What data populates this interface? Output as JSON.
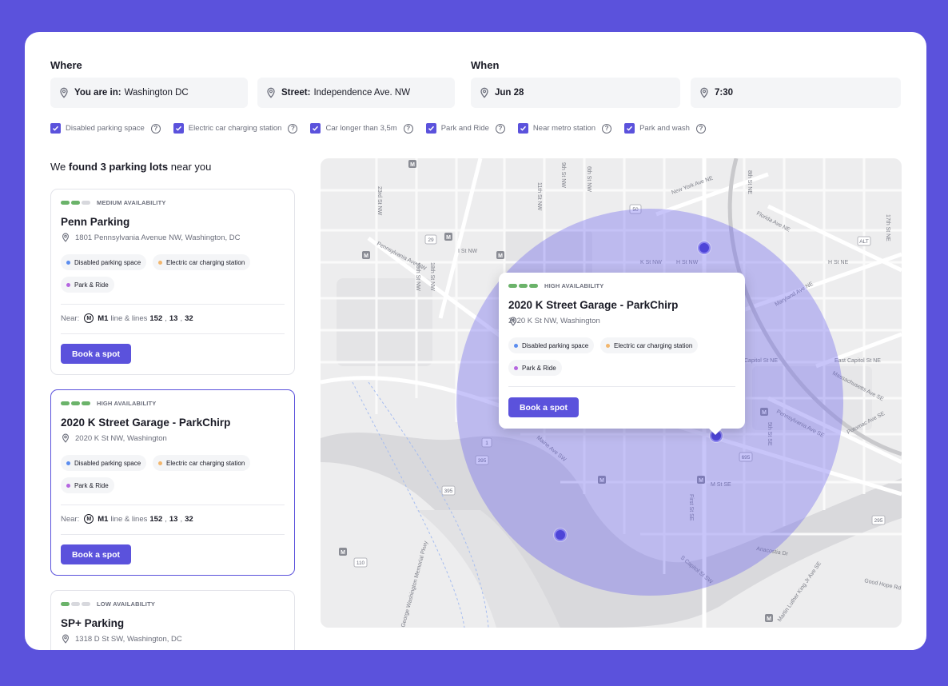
{
  "where": {
    "title": "Where",
    "location_label": "You are in:",
    "location_value": "Washington DC",
    "street_label": "Street:",
    "street_value": "Independence Ave. NW"
  },
  "when": {
    "title": "When",
    "date": "Jun 28",
    "time": "7:30"
  },
  "filters": [
    {
      "label": "Disabled parking space",
      "checked": true
    },
    {
      "label": "Electric car charging station",
      "checked": true
    },
    {
      "label": "Car longer than 3,5m",
      "checked": true
    },
    {
      "label": "Park and Ride",
      "checked": true
    },
    {
      "label": "Near metro station",
      "checked": true
    },
    {
      "label": "Park and wash",
      "checked": true
    }
  ],
  "results": {
    "prefix": "We",
    "highlight": "found 3 parking lots",
    "suffix": "near you"
  },
  "lots": [
    {
      "availability": "MEDIUM AVAILABILITY",
      "level": 2,
      "name": "Penn Parking",
      "address": "1801 Pennsylvania Avenue NW, Washington, DC",
      "tags": [
        "Disabled parking space",
        "Electric car charging station",
        "Park & Ride"
      ],
      "near_label": "Near:",
      "metro_icon": "M",
      "line": "M1",
      "lines_text": "line & lines",
      "line_152": "152",
      "line_13": "13",
      "line_32": "32",
      "button": "Book a spot"
    },
    {
      "availability": "HIGH AVAILABILITY",
      "level": 3,
      "name": "2020 K Street Garage - ParkChirp",
      "address": "2020 K St NW, Washington",
      "tags": [
        "Disabled parking space",
        "Electric car charging station",
        "Park & Ride"
      ],
      "near_label": "Near:",
      "metro_icon": "M",
      "line": "M1",
      "lines_text": "line & lines",
      "line_152": "152",
      "line_13": "13",
      "line_32": "32",
      "button": "Book a spot"
    },
    {
      "availability": "LOW AVAILABILITY",
      "level": 1,
      "name": "SP+ Parking",
      "address": "1318 D St SW, Washington, DC"
    }
  ],
  "popup": {
    "availability": "HIGH AVAILABILITY",
    "name": "2020 K Street Garage - ParkChirp",
    "address": "2020 K St NW, Washington",
    "tags": [
      "Disabled parking space",
      "Electric car charging station",
      "Park & Ride"
    ],
    "button": "Book a spot"
  },
  "map_labels": {
    "new_york_ave": "New York Ave NE",
    "florida_ave": "Florida Ave NE",
    "maryland_ave": "Maryland Ave NE",
    "massachusetts_ave": "Massachusetts Ave SE",
    "pennsylvania_ave": "Pennsylvania Ave SE",
    "potomac_ave": "Potomac Ave SE",
    "pennsylvania_ave_nw": "Pennsylvania Ave NW",
    "maine_ave": "Maine Ave SW",
    "anacostia": "Anacostia Dr",
    "capitol_st": "S Capitol St SW",
    "gw_pkwy": "George Washington Memorial Pkwy",
    "mlk": "Martin Luther King Jr Ave SE",
    "good_hope": "Good Hope Rd SE",
    "east_capitol": "East Capitol St NE",
    "capitol_nw": "Capitol St NE",
    "h_st": "H St NE",
    "h_st_nw": "H St NW",
    "m_st": "M St SE",
    "i_st": "I St NW",
    "k_st": "K St NW",
    "st_23": "23rd St NW",
    "st_19": "19th St NW",
    "st_18": "18th St NW",
    "st_11": "11th St NW",
    "st_9": "9th St NW",
    "st_6": "6th St NW",
    "st_17": "17th St NE",
    "st_8": "8th St NE",
    "st_4": "4th St NE",
    "st_5": "5th St SE",
    "first_st": "First St SE",
    "r50": "50",
    "r29": "29",
    "r1": "1",
    "r395": "395",
    "r295": "295",
    "r110": "110",
    "r695": "695",
    "alt": "ALT",
    "metro": "M"
  },
  "colors": {
    "accent": "#5b52dc",
    "availability_on": "#6bb36a",
    "dot_blue": "#5b8def",
    "dot_orange": "#f2b66d",
    "dot_purple": "#b566e0"
  },
  "icons": {
    "pin": "location-pin-icon",
    "check": "checkmark-icon",
    "help": "question-circle-icon",
    "metro": "metro-icon"
  }
}
